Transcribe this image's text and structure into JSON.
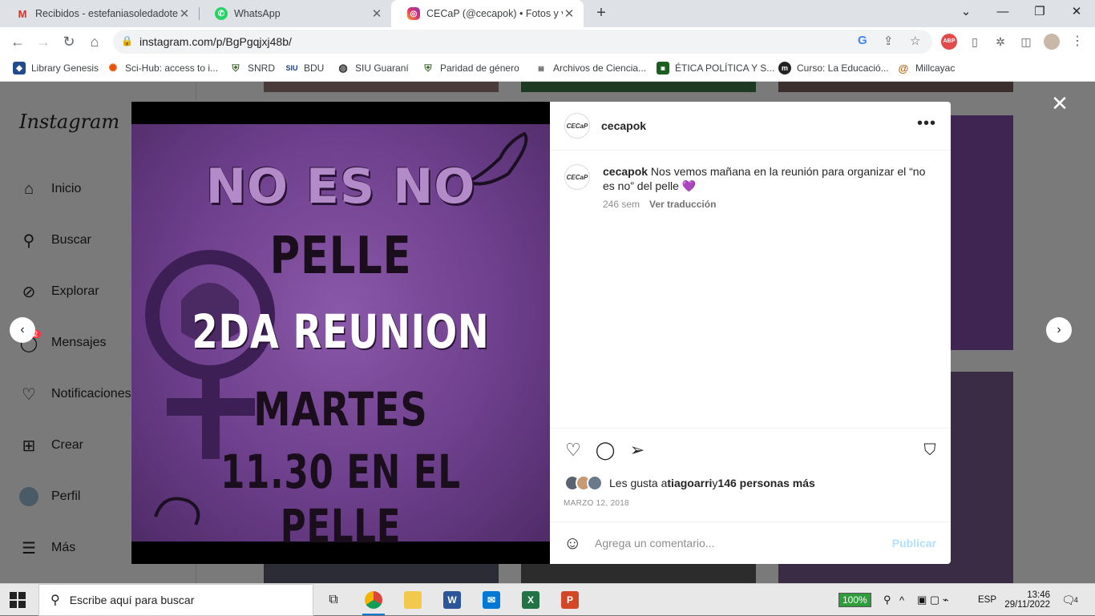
{
  "browser": {
    "tabs": [
      {
        "title": "Recibidos - estefaniasoledadoter",
        "icon": "gmail-icon"
      },
      {
        "title": "WhatsApp",
        "icon": "whatsapp-icon"
      },
      {
        "title": "CECaP (@cecapok) • Fotos y vide",
        "icon": "instagram-icon",
        "active": true
      }
    ],
    "url": "instagram.com/p/BgPgqjxj48b/",
    "abp_label": "ABP"
  },
  "bookmarks": [
    {
      "label": "Library Genesis"
    },
    {
      "label": "Sci-Hub: access to i..."
    },
    {
      "label": "SNRD"
    },
    {
      "label": "BDU"
    },
    {
      "label": "SIU Guaraní"
    },
    {
      "label": "Paridad de género"
    },
    {
      "label": "Archivos de Ciencia..."
    },
    {
      "label": "ÉTICA POLÍTICA Y S..."
    },
    {
      "label": "Curso: La Educació..."
    },
    {
      "label": "Millcayac"
    }
  ],
  "instagram": {
    "logo": "Instagram",
    "nav": [
      {
        "label": "Inicio",
        "icon": "home-icon"
      },
      {
        "label": "Buscar",
        "icon": "search-icon"
      },
      {
        "label": "Explorar",
        "icon": "compass-icon"
      },
      {
        "label": "Mensajes",
        "icon": "messenger-icon",
        "badge": "2"
      },
      {
        "label": "Notificaciones",
        "icon": "heart-icon"
      },
      {
        "label": "Crear",
        "icon": "plus-square-icon"
      },
      {
        "label": "Perfil",
        "icon": "avatar-icon"
      },
      {
        "label": "Más",
        "icon": "menu-icon"
      }
    ]
  },
  "post": {
    "image_lines": [
      "NO ES NO",
      "PELLE",
      "2DA REUNION",
      "MARTES",
      "11.30 EN EL PELLE"
    ],
    "account": "cecapok",
    "avatar_text": "CECaP",
    "caption_user": "cecapok",
    "caption_text": " Nos vemos mañana en la reunión para organizar el “no es no” del pelle 💜",
    "time_ago": "246 sem",
    "translate_label": "Ver traducción",
    "likes_prefix": "Les gusta a ",
    "likes_user": "tiagoarri",
    "likes_mid": " y ",
    "likes_count": "146 personas más",
    "date": "MARZO 12, 2018",
    "comment_placeholder": "Agrega un comentario...",
    "publish_label": "Publicar"
  },
  "taskbar": {
    "search_placeholder": "Escribe aquí para buscar",
    "battery": "100%",
    "lang": "ESP",
    "time": "13:46",
    "date": "29/11/2022",
    "notifications": "4"
  }
}
